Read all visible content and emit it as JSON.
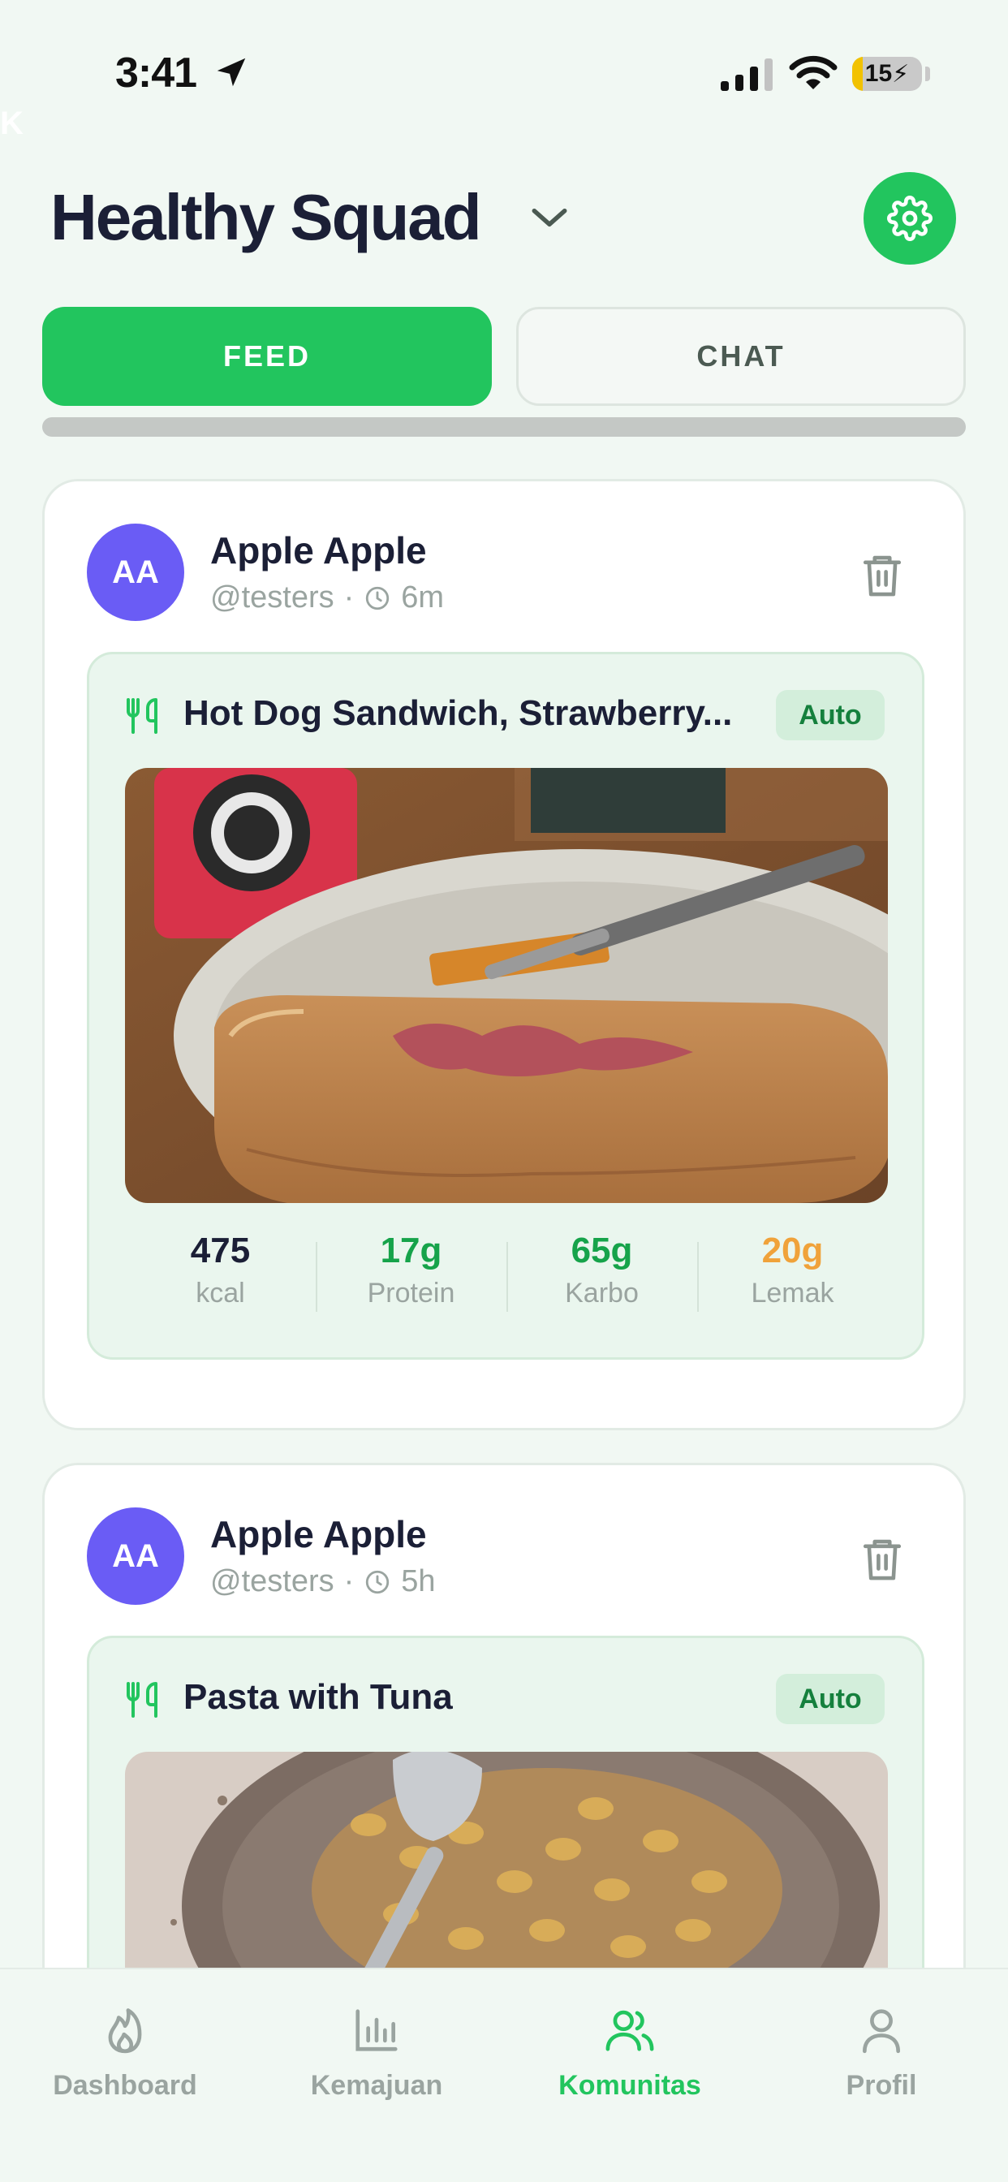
{
  "status_bar": {
    "time": "3:41",
    "battery": "15",
    "battery_level": 0.15,
    "ghost_letter": "K"
  },
  "header": {
    "title": "Healthy Squad"
  },
  "tabs": [
    {
      "label": "FEED",
      "active": true
    },
    {
      "label": "CHAT",
      "active": false
    }
  ],
  "posts": [
    {
      "avatar_initials": "AA",
      "author_name": "Apple Apple",
      "handle": "@testers",
      "separator": "·",
      "time_ago": "6m",
      "meal_name": "Hot Dog Sandwich, Strawberry...",
      "badge": "Auto",
      "photo": "hot-dog-sandwich-photo",
      "nutrition": [
        {
          "value": "475",
          "label": "kcal",
          "color": "#1b1f36"
        },
        {
          "value": "17g",
          "label": "Protein",
          "color": "#16a34a"
        },
        {
          "value": "65g",
          "label": "Karbo",
          "color": "#16a34a"
        },
        {
          "value": "20g",
          "label": "Lemak",
          "color": "#f0a23a"
        }
      ]
    },
    {
      "avatar_initials": "AA",
      "author_name": "Apple Apple",
      "handle": "@testers",
      "separator": "·",
      "time_ago": "5h",
      "meal_name": "Pasta with Tuna",
      "badge": "Auto",
      "photo": "pasta-with-tuna-photo"
    }
  ],
  "bottom_nav": [
    {
      "label": "Dashboard",
      "icon": "flame-icon",
      "active": false
    },
    {
      "label": "Kemajuan",
      "icon": "bar-chart-icon",
      "active": false
    },
    {
      "label": "Komunitas",
      "icon": "users-icon",
      "active": true
    },
    {
      "label": "Profil",
      "icon": "user-icon",
      "active": false
    }
  ],
  "colors": {
    "accent": "#22c55e",
    "avatar": "#6a5cf5",
    "background": "#f1f8f3"
  }
}
